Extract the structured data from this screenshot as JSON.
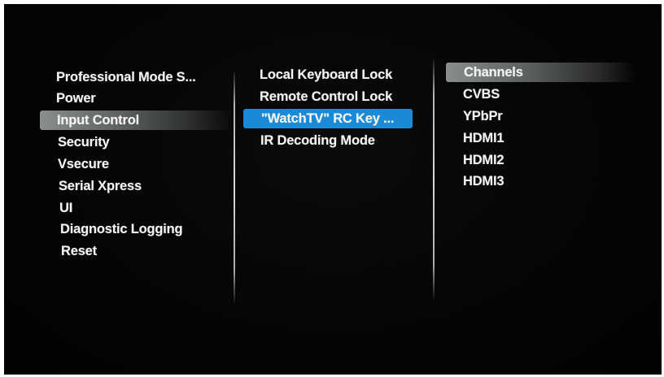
{
  "menu": {
    "column1": {
      "items": [
        {
          "label": "Professional Mode S..."
        },
        {
          "label": "Power"
        },
        {
          "label": "Input Control"
        },
        {
          "label": "Security"
        },
        {
          "label": "Vsecure"
        },
        {
          "label": "Serial Xpress"
        },
        {
          "label": "UI"
        },
        {
          "label": "Diagnostic Logging"
        },
        {
          "label": "Reset"
        }
      ],
      "selected": "Input Control"
    },
    "column2": {
      "items": [
        {
          "label": "Local Keyboard Lock"
        },
        {
          "label": "Remote Control Lock"
        },
        {
          "label": "\"WatchTV\" RC Key ..."
        },
        {
          "label": "IR Decoding Mode"
        }
      ],
      "focused": "\"WatchTV\" RC Key ..."
    },
    "column3": {
      "items": [
        {
          "label": "Channels"
        },
        {
          "label": "CVBS"
        },
        {
          "label": "YPbPr"
        },
        {
          "label": "HDMI1"
        },
        {
          "label": "HDMI2"
        },
        {
          "label": "HDMI3"
        }
      ],
      "selected": "Channels"
    }
  },
  "colors": {
    "background": "#050506",
    "text": "#f4f4f4",
    "focus_highlight": "#1a8ad6",
    "selection_highlight": "#8a8d8e"
  }
}
